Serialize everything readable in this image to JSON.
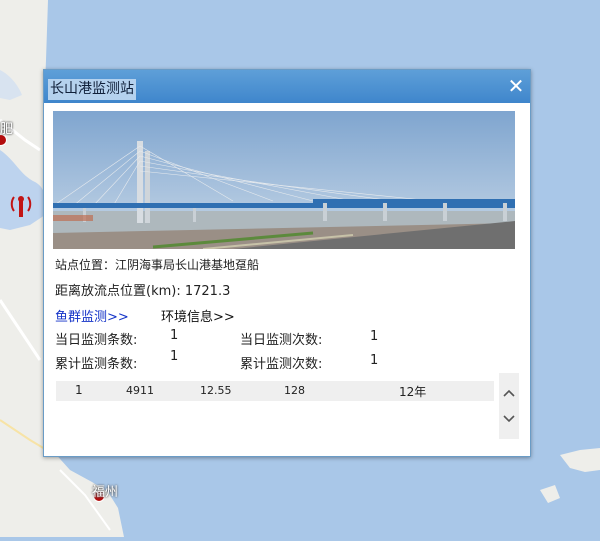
{
  "map": {
    "labels": {
      "hefei": "肥",
      "fuzhou": "福州"
    },
    "colors": {
      "sea": "#a9c7e8",
      "land": "#eeeeea",
      "water_body": "#bdd3ee",
      "road": "#ffffff",
      "marker": "#b30d0d"
    }
  },
  "popup": {
    "title": "长山港监测站",
    "close_icon": "close-icon",
    "photo_subject": "bridge-photo",
    "site_label": "站点位置：",
    "site_value": "江阴海事局长山港基地趸船",
    "distance_label": "距离放流点位置(km):",
    "distance_value": "1721.3",
    "tabs": [
      {
        "label": "鱼群监测>>",
        "active": true
      },
      {
        "label": "环境信息>>",
        "active": false
      }
    ],
    "stats": {
      "today_records_label": "当日监测条数:",
      "today_records_value": "1",
      "today_times_label": "当日监测次数:",
      "today_times_value": "1",
      "total_records_label": "累计监测条数:",
      "total_records_value": "1",
      "total_times_label": "累计监测次数:",
      "total_times_value": "1"
    },
    "table_row": [
      "1",
      "4911",
      "12.55",
      "128",
      "12年"
    ],
    "scroll": {
      "up_icon": "chevron-up-icon",
      "down_icon": "chevron-down-icon"
    }
  }
}
